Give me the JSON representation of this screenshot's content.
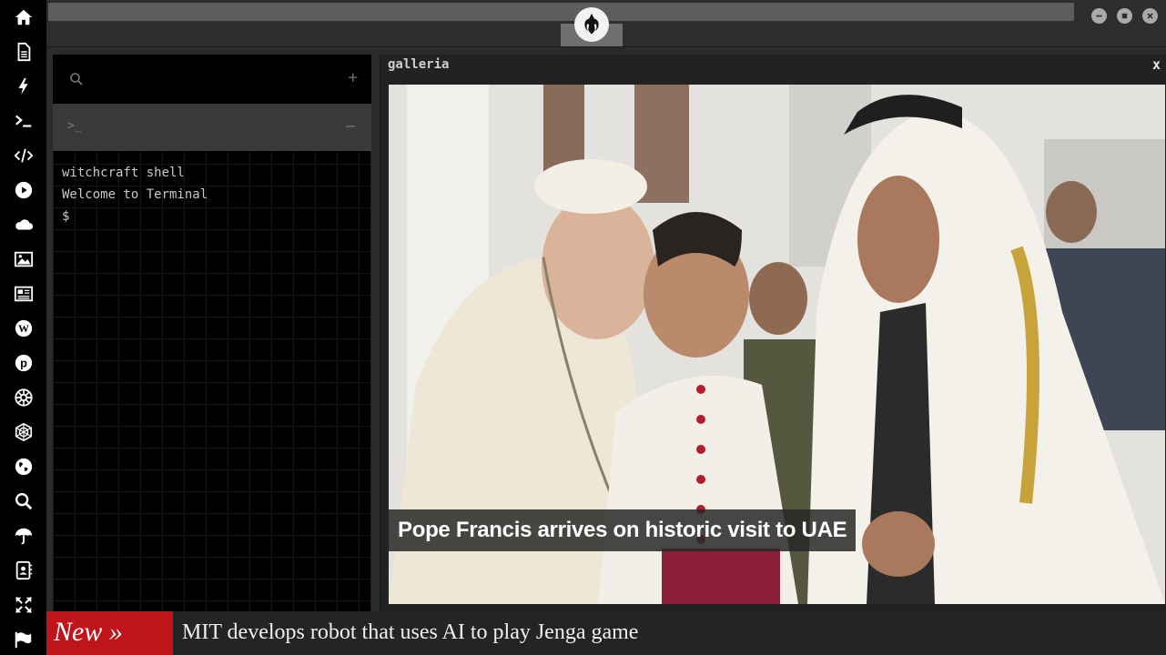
{
  "sidebar": {
    "icons": [
      "home-icon",
      "document-icon",
      "bolt-icon",
      "terminal-icon",
      "code-icon",
      "play-icon",
      "cloud-icon",
      "image-icon",
      "newspaper-icon",
      "wordpress-icon",
      "pinterest-icon",
      "galactic-empire-icon",
      "death-star-icon",
      "globe-icon",
      "search-icon",
      "umbrella-icon",
      "contacts-icon",
      "expand-icon",
      "flag-icon"
    ]
  },
  "topbar": {
    "logo": "rebel-alliance-icon",
    "window_buttons": [
      "minimize-icon",
      "maximize-icon",
      "close-icon"
    ]
  },
  "terminal": {
    "plus": "+",
    "prompt_icon": ">_",
    "minus": "−",
    "lines": [
      "witchcraft shell",
      "Welcome to Terminal",
      "$"
    ]
  },
  "gallery": {
    "title": "galleria",
    "close": "x",
    "caption": "Pope Francis arrives on historic visit to UAE"
  },
  "ticker": {
    "badge": "New »",
    "headline": "MIT develops robot that uses AI to play Jenga game"
  },
  "colors": {
    "ticker_badge": "#c0141b",
    "background": "#2b2b2b"
  }
}
